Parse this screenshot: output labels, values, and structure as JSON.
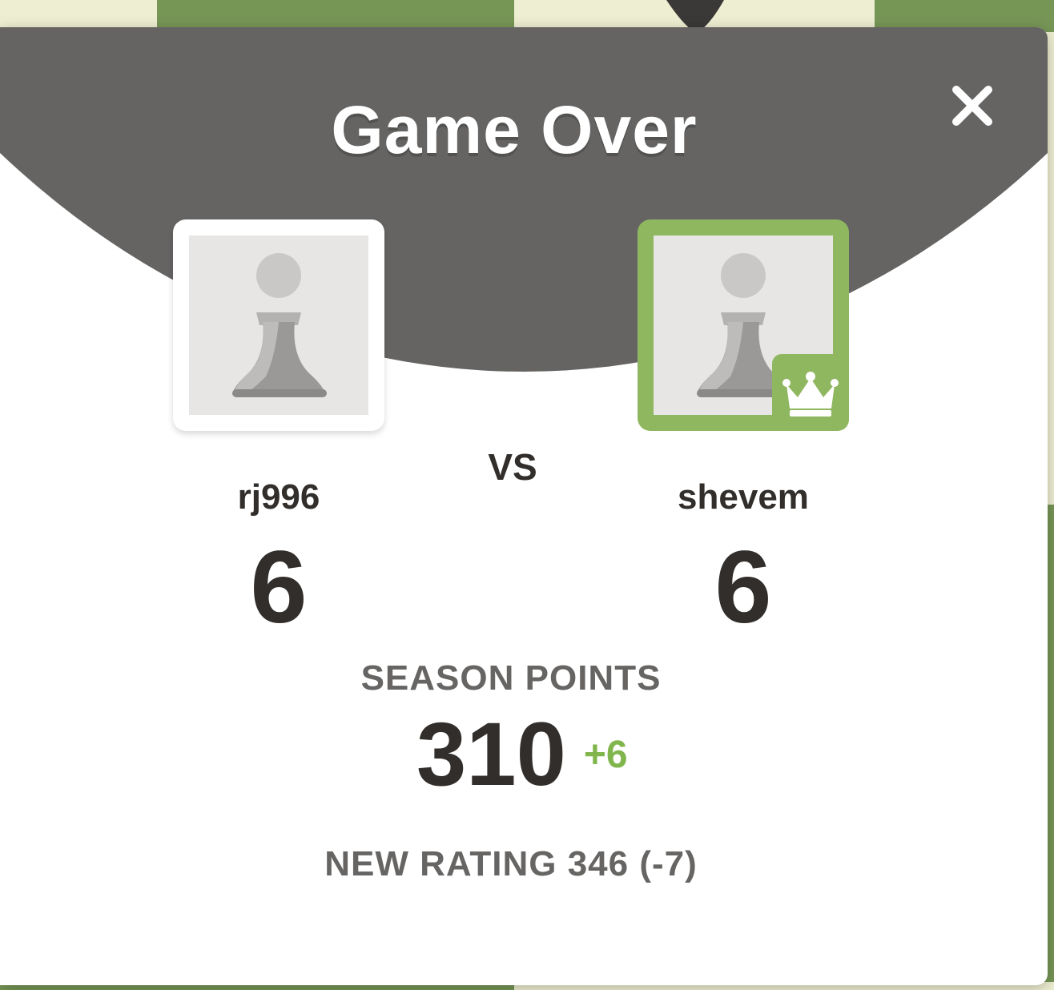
{
  "colors": {
    "header": "#656463",
    "winner_accent": "#8fb760",
    "gain_text": "#81b64c",
    "board_dark": "#769656",
    "board_light": "#eeeed2",
    "primary_text": "#312e2b",
    "muted_text": "#666563"
  },
  "dialog": {
    "title": "Game Over",
    "close_icon": "close-icon"
  },
  "players": {
    "left": {
      "username": "rj996",
      "score": "6",
      "avatar_icon": "pawn-icon"
    },
    "right": {
      "username": "shevem",
      "score": "6",
      "avatar_icon": "pawn-icon",
      "winner_icon": "crown-icon"
    }
  },
  "vs_label": "VS",
  "season": {
    "label": "SEASON POINTS",
    "value": "310",
    "delta": "+6"
  },
  "rating": {
    "text": "NEW RATING 346 (-7)"
  }
}
